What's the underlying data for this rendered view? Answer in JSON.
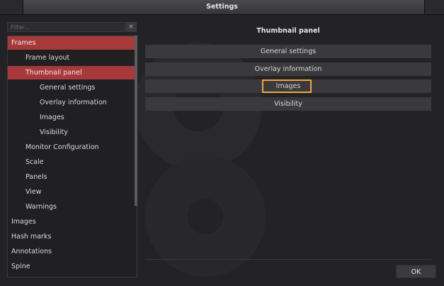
{
  "window": {
    "title": "Settings"
  },
  "filter": {
    "placeholder": "Filter..."
  },
  "clear_button": {
    "label": "×"
  },
  "tree": {
    "items": [
      {
        "label": "Frames",
        "indent": 0,
        "selected": true
      },
      {
        "label": "Frame layout",
        "indent": 1,
        "selected": false
      },
      {
        "label": "Thumbnail panel",
        "indent": 1,
        "selected": true
      },
      {
        "label": "General settings",
        "indent": 2,
        "selected": false
      },
      {
        "label": "Overlay information",
        "indent": 2,
        "selected": false
      },
      {
        "label": "Images",
        "indent": 2,
        "selected": false
      },
      {
        "label": "Visibility",
        "indent": 2,
        "selected": false
      },
      {
        "label": "Monitor Configuration",
        "indent": 1,
        "selected": false
      },
      {
        "label": "Scale",
        "indent": 1,
        "selected": false
      },
      {
        "label": "Panels",
        "indent": 1,
        "selected": false
      },
      {
        "label": "View",
        "indent": 1,
        "selected": false
      },
      {
        "label": "Warnings",
        "indent": 1,
        "selected": false
      },
      {
        "label": "Images",
        "indent": 0,
        "selected": false
      },
      {
        "label": "Hash marks",
        "indent": 0,
        "selected": false
      },
      {
        "label": "Annotations",
        "indent": 0,
        "selected": false
      },
      {
        "label": "Spine",
        "indent": 0,
        "selected": false
      }
    ]
  },
  "panel": {
    "title": "Thumbnail panel",
    "buttons": [
      {
        "label": "General settings",
        "highlighted": false
      },
      {
        "label": "Overlay information",
        "highlighted": false
      },
      {
        "label": "Images",
        "highlighted": true
      },
      {
        "label": "Visibility",
        "highlighted": false
      }
    ]
  },
  "footer": {
    "ok_label": "OK"
  },
  "colors": {
    "selection": "#a8393a",
    "highlight_border": "#f0a24a",
    "background": "#232325"
  }
}
